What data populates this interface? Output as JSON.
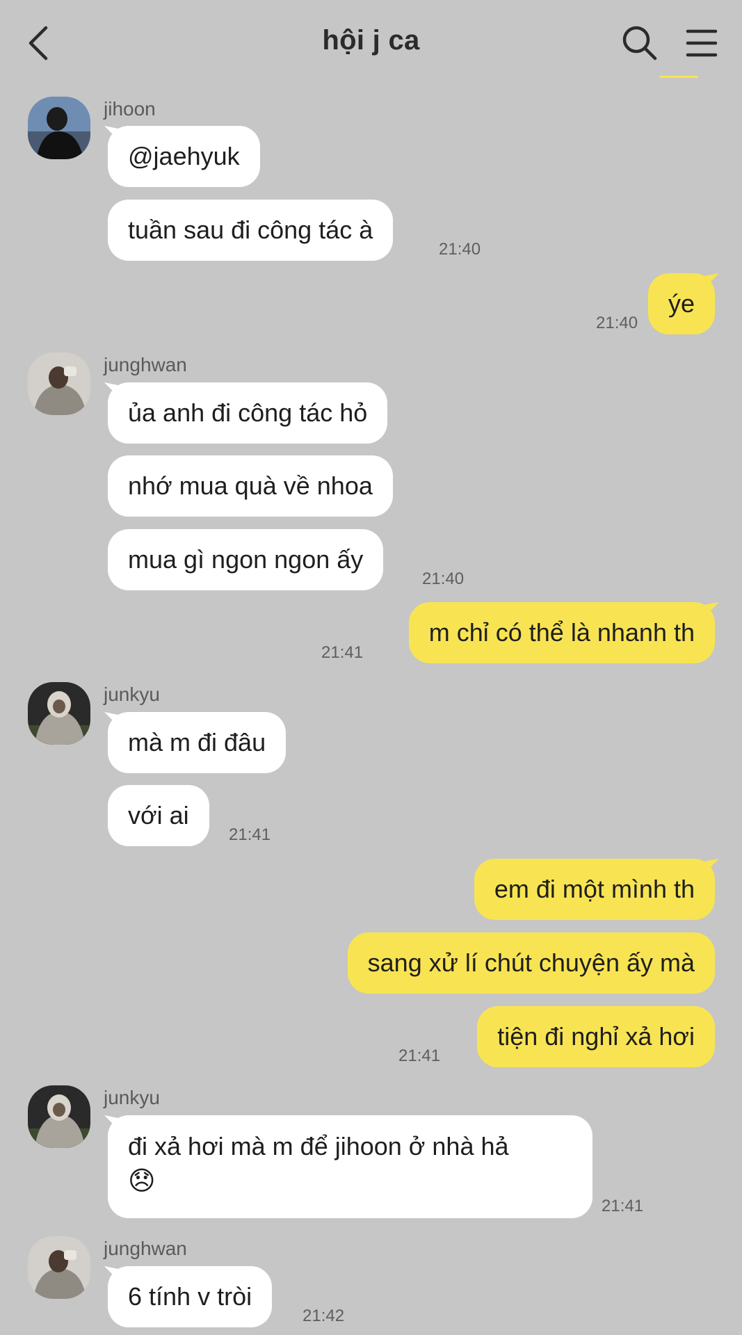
{
  "header": {
    "title": "hội j ca"
  },
  "colors": {
    "background": "#c6c6c6",
    "outgoing_bubble": "#f8e452",
    "incoming_bubble": "#ffffff"
  },
  "messages": [
    {
      "sender": "jihoon",
      "texts": [
        "@jaehyuk",
        "tuần sau đi công tác à"
      ],
      "time": "21:40"
    },
    {
      "sender": "me",
      "texts": [
        "ýe"
      ],
      "time": "21:40"
    },
    {
      "sender": "junghwan",
      "texts": [
        "ủa anh đi công tác hỏ",
        "nhớ mua quà về nhoa",
        "mua gì ngon ngon ấy"
      ],
      "time": "21:40"
    },
    {
      "sender": "me",
      "texts": [
        "m chỉ có thể là nhanh th"
      ],
      "time": "21:41"
    },
    {
      "sender": "junkyu",
      "texts": [
        "mà m đi đâu",
        "với ai"
      ],
      "time": "21:41"
    },
    {
      "sender": "me",
      "texts": [
        "em đi một mình th",
        "sang xử lí chút chuyện ấy mà",
        "tiện đi nghỉ xả hơi"
      ],
      "time": "21:41"
    },
    {
      "sender": "junkyu",
      "texts": [
        "đi xả hơi mà m để jihoon ở nhà hả",
        "😞"
      ],
      "time": "21:41"
    },
    {
      "sender": "junghwan",
      "texts": [
        "6 tính v tròi"
      ],
      "time": "21:42"
    }
  ]
}
